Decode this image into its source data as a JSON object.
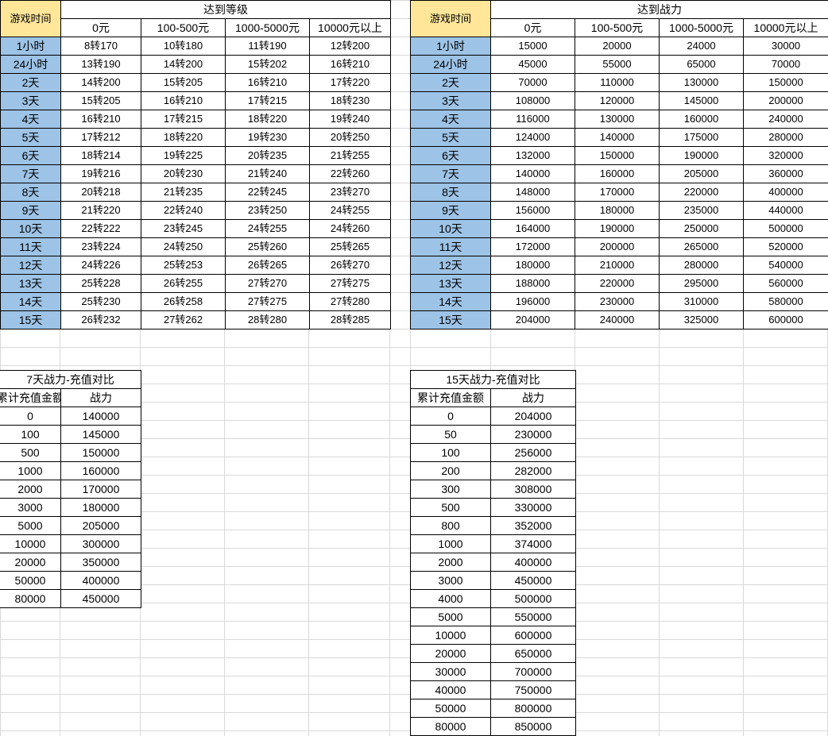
{
  "level_table": {
    "corner": "游戏时间",
    "group_header": "达到等级",
    "columns": [
      "0元",
      "100-500元",
      "1000-5000元",
      "10000元以上"
    ],
    "rows": [
      {
        "time": "1小时",
        "values": [
          "8转170",
          "10转180",
          "11转190",
          "12转200"
        ]
      },
      {
        "time": "24小时",
        "values": [
          "13转190",
          "14转200",
          "15转202",
          "16转210"
        ]
      },
      {
        "time": "2天",
        "values": [
          "14转200",
          "15转205",
          "16转210",
          "17转220"
        ]
      },
      {
        "time": "3天",
        "values": [
          "15转205",
          "16转210",
          "17转215",
          "18转230"
        ]
      },
      {
        "time": "4天",
        "values": [
          "16转210",
          "17转215",
          "18转220",
          "19转240"
        ]
      },
      {
        "time": "5天",
        "values": [
          "17转212",
          "18转220",
          "19转230",
          "20转250"
        ]
      },
      {
        "time": "6天",
        "values": [
          "18转214",
          "19转225",
          "20转235",
          "21转255"
        ]
      },
      {
        "time": "7天",
        "values": [
          "19转216",
          "20转230",
          "21转240",
          "22转260"
        ]
      },
      {
        "time": "8天",
        "values": [
          "20转218",
          "21转235",
          "22转245",
          "23转270"
        ]
      },
      {
        "time": "9天",
        "values": [
          "21转220",
          "22转240",
          "23转250",
          "24转255"
        ]
      },
      {
        "time": "10天",
        "values": [
          "22转222",
          "23转245",
          "24转255",
          "24转260"
        ]
      },
      {
        "time": "11天",
        "values": [
          "23转224",
          "24转250",
          "25转260",
          "25转265"
        ]
      },
      {
        "time": "12天",
        "values": [
          "24转226",
          "25转253",
          "26转265",
          "26转270"
        ]
      },
      {
        "time": "13天",
        "values": [
          "25转228",
          "26转255",
          "27转270",
          "27转275"
        ]
      },
      {
        "time": "14天",
        "values": [
          "25转230",
          "26转258",
          "27转275",
          "27转280"
        ]
      },
      {
        "time": "15天",
        "values": [
          "26转232",
          "27转262",
          "28转280",
          "28转285"
        ]
      }
    ]
  },
  "power_table": {
    "corner": "游戏时间",
    "group_header": "达到战力",
    "columns": [
      "0元",
      "100-500元",
      "1000-5000元",
      "10000元以上"
    ],
    "rows": [
      {
        "time": "1小时",
        "values": [
          "15000",
          "20000",
          "24000",
          "30000"
        ]
      },
      {
        "time": "24小时",
        "values": [
          "45000",
          "55000",
          "65000",
          "70000"
        ]
      },
      {
        "time": "2天",
        "values": [
          "70000",
          "110000",
          "130000",
          "150000"
        ]
      },
      {
        "time": "3天",
        "values": [
          "108000",
          "120000",
          "145000",
          "200000"
        ]
      },
      {
        "time": "4天",
        "values": [
          "116000",
          "130000",
          "160000",
          "240000"
        ]
      },
      {
        "time": "5天",
        "values": [
          "124000",
          "140000",
          "175000",
          "280000"
        ]
      },
      {
        "time": "6天",
        "values": [
          "132000",
          "150000",
          "190000",
          "320000"
        ]
      },
      {
        "time": "7天",
        "values": [
          "140000",
          "160000",
          "205000",
          "360000"
        ]
      },
      {
        "time": "8天",
        "values": [
          "148000",
          "170000",
          "220000",
          "400000"
        ]
      },
      {
        "time": "9天",
        "values": [
          "156000",
          "180000",
          "235000",
          "440000"
        ]
      },
      {
        "time": "10天",
        "values": [
          "164000",
          "190000",
          "250000",
          "500000"
        ]
      },
      {
        "time": "11天",
        "values": [
          "172000",
          "200000",
          "265000",
          "520000"
        ]
      },
      {
        "time": "12天",
        "values": [
          "180000",
          "210000",
          "280000",
          "540000"
        ]
      },
      {
        "time": "13天",
        "values": [
          "188000",
          "220000",
          "295000",
          "560000"
        ]
      },
      {
        "time": "14天",
        "values": [
          "196000",
          "230000",
          "310000",
          "580000"
        ]
      },
      {
        "time": "15天",
        "values": [
          "204000",
          "240000",
          "325000",
          "600000"
        ]
      }
    ]
  },
  "day7_table": {
    "title": "7天战力-充值对比",
    "col_amount": "累计充值金额",
    "col_power": "战力",
    "rows": [
      [
        "0",
        "140000"
      ],
      [
        "100",
        "145000"
      ],
      [
        "500",
        "150000"
      ],
      [
        "1000",
        "160000"
      ],
      [
        "2000",
        "170000"
      ],
      [
        "3000",
        "180000"
      ],
      [
        "5000",
        "205000"
      ],
      [
        "10000",
        "300000"
      ],
      [
        "20000",
        "350000"
      ],
      [
        "50000",
        "400000"
      ],
      [
        "80000",
        "450000"
      ]
    ]
  },
  "day15_table": {
    "title": "15天战力-充值对比",
    "col_amount": "累计充值金额",
    "col_power": "战力",
    "rows": [
      [
        "0",
        "204000"
      ],
      [
        "50",
        "230000"
      ],
      [
        "100",
        "256000"
      ],
      [
        "200",
        "282000"
      ],
      [
        "300",
        "308000"
      ],
      [
        "500",
        "330000"
      ],
      [
        "800",
        "352000"
      ],
      [
        "1000",
        "374000"
      ],
      [
        "2000",
        "400000"
      ],
      [
        "3000",
        "450000"
      ],
      [
        "4000",
        "500000"
      ],
      [
        "5000",
        "550000"
      ],
      [
        "10000",
        "600000"
      ],
      [
        "20000",
        "650000"
      ],
      [
        "30000",
        "700000"
      ],
      [
        "40000",
        "750000"
      ],
      [
        "50000",
        "800000"
      ],
      [
        "80000",
        "850000"
      ]
    ]
  },
  "colors": {
    "corner_fill": "#ffe699",
    "time_fill": "#9dc3e6",
    "gridline": "#d9d9d9",
    "border": "#000000"
  }
}
